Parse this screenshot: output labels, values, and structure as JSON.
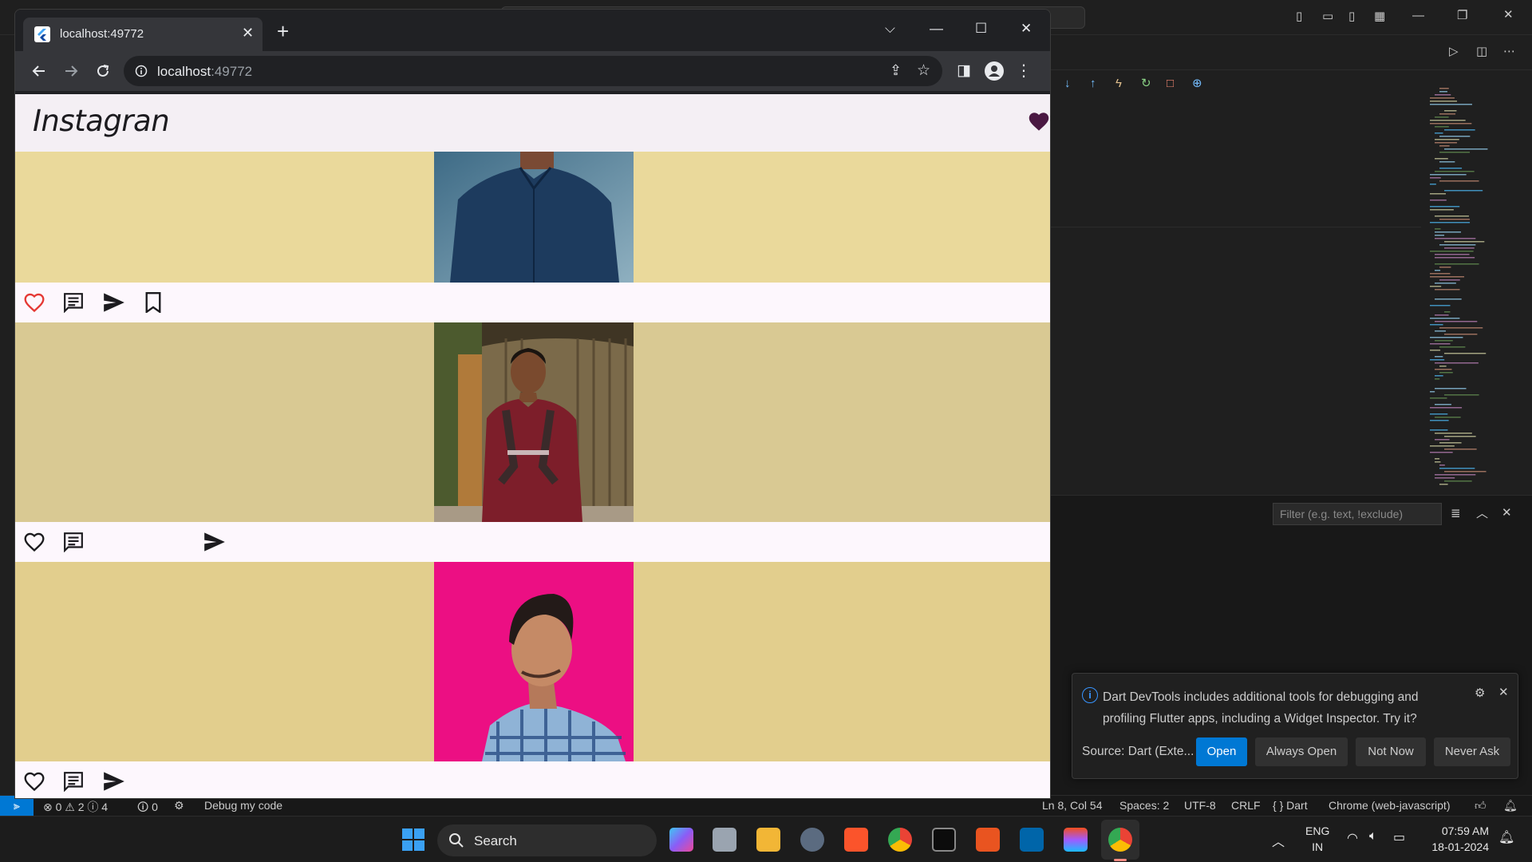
{
  "chrome": {
    "tab_title": "localhost:49772",
    "url_host": "localhost",
    "url_port": ":49772"
  },
  "app": {
    "title": "Instagran",
    "posts": [
      {
        "bg": "#ead99b",
        "photo": "man in navy shirt",
        "liked": true,
        "bookmark": true
      },
      {
        "bg": "#d9c993",
        "photo": "man in maroon t-shirt",
        "liked": false,
        "bookmark": false
      },
      {
        "bg": "#e2ce8d",
        "photo": "man in checked shirt on pink",
        "liked": false,
        "bookmark": false
      }
    ],
    "accent_heart": "#4a1842",
    "liked_color": "#e53935"
  },
  "vscode": {
    "filter_placeholder": "Filter (e.g. text, !exclude)",
    "status": {
      "problems": "⊗ 0 ⚠ 2 ⓘ 4",
      "ports": "🛈 0",
      "debug": "Debug my code",
      "position": "Ln 8, Col 54",
      "spaces": "Spaces: 2",
      "encoding": "UTF-8",
      "eol": "CRLF",
      "language": "{ } Dart",
      "device": "Chrome (web-javascript)"
    },
    "notification": {
      "message": "Dart DevTools includes additional tools for debugging and profiling Flutter apps, including a Widget Inspector. Try it?",
      "source": "Source: Dart (Exte...",
      "buttons": [
        "Open",
        "Always Open",
        "Not Now",
        "Never Ask"
      ]
    }
  },
  "taskbar": {
    "search": "Search",
    "lang1": "ENG",
    "lang2": "IN",
    "time": "07:59 AM",
    "date": "18-01-2024"
  }
}
